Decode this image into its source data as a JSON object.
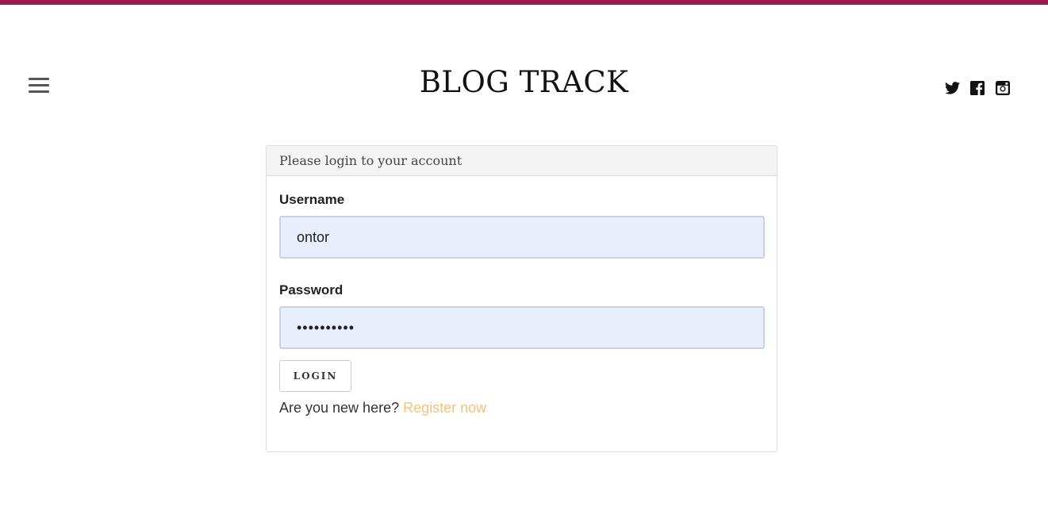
{
  "header": {
    "brand": "BLOG TRACK",
    "menu_icon": "hamburger-menu-icon",
    "social": [
      {
        "name": "twitter",
        "icon": "twitter-icon"
      },
      {
        "name": "facebook",
        "icon": "facebook-icon"
      },
      {
        "name": "instagram",
        "icon": "instagram-icon"
      }
    ]
  },
  "colors": {
    "accent_bar": "#9a1a4e",
    "input_fill": "#e8effc",
    "link": "#f5c27a"
  },
  "login_panel": {
    "heading": "Please login to your account",
    "username_label": "Username",
    "username_value": "ontor",
    "password_label": "Password",
    "password_value": "••••••••••",
    "login_button": "LOGIN",
    "register_prompt": "Are you new here? ",
    "register_link": "Register now"
  }
}
